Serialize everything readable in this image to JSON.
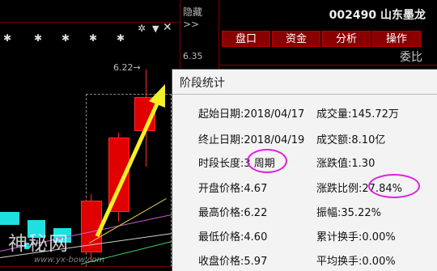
{
  "chart": {
    "hide_label": "隐藏>>",
    "price_label_top": "6.35",
    "high_label": "6.22→",
    "gear_icon": "gear-icon",
    "settings_icon": "triangle-icon",
    "close_icon": "close-icon",
    "star_icon": "star-icon"
  },
  "watermark": {
    "text": "神秘网",
    "url": "www.yx-bow.com"
  },
  "stock": {
    "code": "002490",
    "name": "山东墨龙"
  },
  "tabs": [
    {
      "label": "盘口"
    },
    {
      "label": "资金"
    },
    {
      "label": "分析"
    },
    {
      "label": "操作"
    }
  ],
  "weibi_label": "委比",
  "popup": {
    "title": "阶段统计",
    "left": [
      {
        "label": "起始日期:",
        "value": "2018/04/17"
      },
      {
        "label": "终止日期:",
        "value": "2018/04/19"
      },
      {
        "label": "时段长度:",
        "value": "3 周期"
      },
      {
        "label": "开盘价格:",
        "value": "4.67"
      },
      {
        "label": "最高价格:",
        "value": "6.22"
      },
      {
        "label": "最低价格:",
        "value": "4.60"
      },
      {
        "label": "收盘价格:",
        "value": "5.97"
      }
    ],
    "right": [
      {
        "label": "成交量:",
        "value": "145.72万"
      },
      {
        "label": "成交额:",
        "value": "8.10亿"
      },
      {
        "label": "涨跌值:",
        "value": "1.30"
      },
      {
        "label": "涨跌比例:",
        "value": "27.84%"
      },
      {
        "label": "振幅:",
        "value": "35.22%"
      },
      {
        "label": "累计换手:",
        "value": "0.00%"
      },
      {
        "label": "平均换手:",
        "value": "0.00%"
      }
    ]
  },
  "colors": {
    "up_candle": "#e00000",
    "down_candle": "#1fe0e0",
    "arrow": "#f5ef2a",
    "highlight_oval": "#e020e0",
    "tab_bg": "#8a0000"
  }
}
